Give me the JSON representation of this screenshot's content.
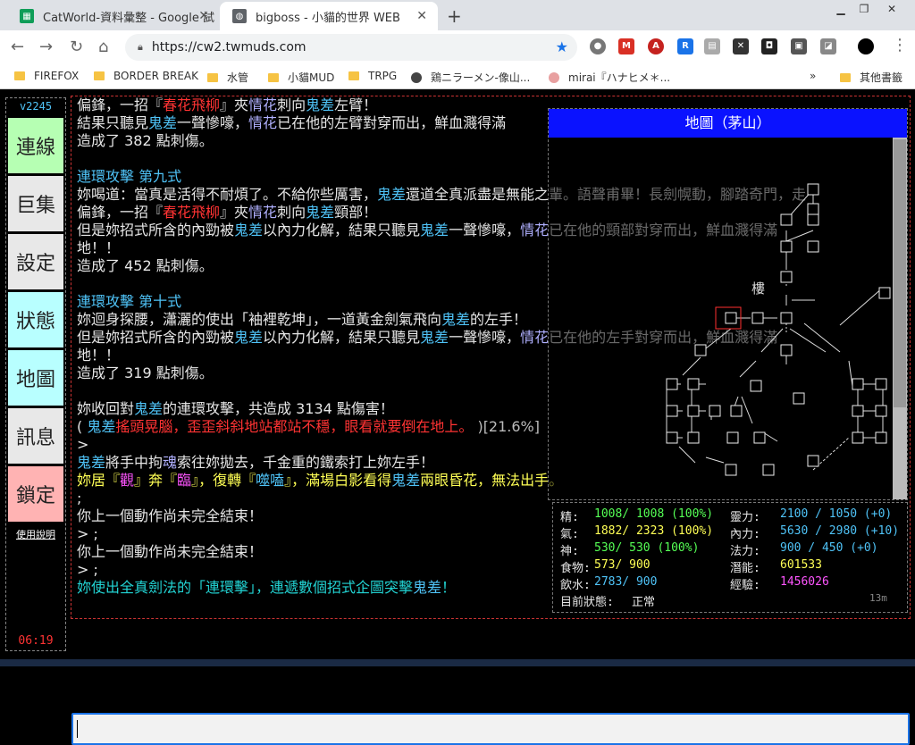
{
  "browser": {
    "tabs": [
      {
        "title": "CatWorld-資料彙整 - Google 試",
        "icon": "sheets-icon",
        "color": "#0f9d58"
      },
      {
        "title": "bigboss - 小貓的世界 WEB",
        "icon": "globe-icon",
        "color": "#5f6368"
      }
    ],
    "url": "https://cw2.twmuds.com",
    "bookmarks": [
      "FIREFOX",
      "BORDER BREAK",
      "水管",
      "小貓MUD",
      "TRPG",
      "鶏ニラーメン-像山...",
      "mirai『ハナヒメ＊...",
      "其他書籤"
    ]
  },
  "sidebar": {
    "version": "v2245",
    "buttons": [
      {
        "label": "連線",
        "color": "#b6ffb3"
      },
      {
        "label": "巨集",
        "color": "#e8e8e8"
      },
      {
        "label": "設定",
        "color": "#e8e8e8"
      },
      {
        "label": "狀態",
        "color": "#b8ffff"
      },
      {
        "label": "地圖",
        "color": "#b8ffff"
      },
      {
        "label": "訊息",
        "color": "#e8e8e8"
      },
      {
        "label": "鎖定",
        "color": "#ffb3b3"
      }
    ],
    "help": "使用說明",
    "clock": "06:19"
  },
  "output": [
    [
      [
        "偏鋒，一招『",
        "#e6e6e6"
      ],
      [
        "春花飛柳",
        "#ff3333"
      ],
      [
        "』夾",
        "#e6e6e6"
      ],
      [
        "情花",
        "#b0b0ff"
      ],
      [
        "刺向",
        "#e6e6e6"
      ],
      [
        "鬼差",
        "#4fc3f7"
      ],
      [
        "左臂！",
        "#e6e6e6"
      ]
    ],
    [
      [
        "結果只聽見",
        "#e6e6e6"
      ],
      [
        "鬼差",
        "#4fc3f7"
      ],
      [
        "一聲慘嚎，",
        "#e6e6e6"
      ],
      [
        "情花",
        "#b0b0ff"
      ],
      [
        "已在他的左臂對穿而出，鮮血濺得滿",
        "#e6e6e6"
      ]
    ],
    [
      [
        "造成了 382 點刺傷。",
        "#e6e6e6"
      ]
    ],
    [
      [
        "",
        "#e6e6e6"
      ]
    ],
    [
      [
        "連環攻擊 第九式",
        "#4fc3f7"
      ]
    ],
    [
      [
        "妳喝道：當真是活得不耐煩了。不給你些厲害，",
        "#e6e6e6"
      ],
      [
        "鬼差",
        "#4fc3f7"
      ],
      [
        "還道全真派盡是無能之輩。語聲甫畢！長劍幌動，腳踏奇門，走",
        "#e6e6e6"
      ]
    ],
    [
      [
        "偏鋒，一招『",
        "#e6e6e6"
      ],
      [
        "春花飛柳",
        "#ff3333"
      ],
      [
        "』夾",
        "#e6e6e6"
      ],
      [
        "情花",
        "#b0b0ff"
      ],
      [
        "刺向",
        "#e6e6e6"
      ],
      [
        "鬼差",
        "#4fc3f7"
      ],
      [
        "頸部！",
        "#e6e6e6"
      ]
    ],
    [
      [
        "但是妳招式所含的內勁被",
        "#e6e6e6"
      ],
      [
        "鬼差",
        "#4fc3f7"
      ],
      [
        "以內力化解，結果只聽見",
        "#e6e6e6"
      ],
      [
        "鬼差",
        "#4fc3f7"
      ],
      [
        "一聲慘嚎，",
        "#e6e6e6"
      ],
      [
        "情花",
        "#b0b0ff"
      ],
      [
        "已在他的頸部對穿而出，鮮血濺得滿",
        "#e6e6e6"
      ]
    ],
    [
      [
        "地！！",
        "#e6e6e6"
      ]
    ],
    [
      [
        "造成了 452 點刺傷。",
        "#e6e6e6"
      ]
    ],
    [
      [
        "",
        "#e6e6e6"
      ]
    ],
    [
      [
        "連環攻擊 第十式",
        "#4fc3f7"
      ]
    ],
    [
      [
        "妳迴身探腰，瀟灑的使出「袖裡乾坤」，一道黃金劍氣飛向",
        "#e6e6e6"
      ],
      [
        "鬼差",
        "#4fc3f7"
      ],
      [
        "的左手！",
        "#e6e6e6"
      ]
    ],
    [
      [
        "但是妳招式所含的內勁被",
        "#e6e6e6"
      ],
      [
        "鬼差",
        "#4fc3f7"
      ],
      [
        "以內力化解，結果只聽見",
        "#e6e6e6"
      ],
      [
        "鬼差",
        "#4fc3f7"
      ],
      [
        "一聲慘嚎，",
        "#e6e6e6"
      ],
      [
        "情花",
        "#b0b0ff"
      ],
      [
        "已在他的左手對穿而出，鮮血濺得滿",
        "#e6e6e6"
      ]
    ],
    [
      [
        "地！！",
        "#e6e6e6"
      ]
    ],
    [
      [
        "造成了 319 點刺傷。",
        "#e6e6e6"
      ]
    ],
    [
      [
        "",
        "#e6e6e6"
      ]
    ],
    [
      [
        "妳收回對",
        "#e6e6e6"
      ],
      [
        "鬼差",
        "#4fc3f7"
      ],
      [
        "的連環攻擊，共造成 3134 點傷害！",
        "#e6e6e6"
      ]
    ],
    [
      [
        "( ",
        "#e6e6e6"
      ],
      [
        "鬼差",
        "#4fc3f7"
      ],
      [
        "搖頭晃腦，歪歪斜斜地站都站不穩，眼看就要倒在地上。",
        "#ff3333"
      ],
      [
        " )[21.6%]",
        "#bbbbbb"
      ]
    ],
    [
      [
        ">",
        "#e6e6e6"
      ]
    ],
    [
      [
        "鬼差",
        "#4fc3f7"
      ],
      [
        "將手中拘",
        "#e6e6e6"
      ],
      [
        "魂",
        "#b0b0ff"
      ],
      [
        "索往妳拋去，千金重的鐵索打上妳左手！",
        "#e6e6e6"
      ]
    ],
    [
      [
        "妳居『",
        "#ffff55"
      ],
      [
        "觀",
        "#ff55ff"
      ],
      [
        "』奔『",
        "#ffff55"
      ],
      [
        "臨",
        "#ff55ff"
      ],
      [
        "』，復轉『",
        "#ffff55"
      ],
      [
        "噬嗑",
        "#4fc3f7"
      ],
      [
        "』，滿場白影看得",
        "#ffff55"
      ],
      [
        "鬼差",
        "#4fc3f7"
      ],
      [
        "兩眼昏花，無法出手。",
        "#ffff55"
      ]
    ],
    [
      [
        ";",
        "#e6e6e6"
      ]
    ],
    [
      [
        "你上一個動作尚未完全結束！",
        "#e6e6e6"
      ]
    ],
    [
      [
        "> ;",
        "#e6e6e6"
      ]
    ],
    [
      [
        "你上一個動作尚未完全結束！",
        "#e6e6e6"
      ]
    ],
    [
      [
        "> ;",
        "#e6e6e6"
      ]
    ],
    [
      [
        "妳使出全真劍法的「連環擊」，連遞數個招式企圖突擊",
        "#22d3d3"
      ],
      [
        "鬼差",
        "#4fc3f7"
      ],
      [
        "！",
        "#22d3d3"
      ]
    ]
  ],
  "map": {
    "title": "地圖（茅山）",
    "tower_label": "樓"
  },
  "status": {
    "rows": [
      {
        "l_label": "精:",
        "l_value": "1008/ 1008 (100%)",
        "r_label": "靈力:",
        "r_value": "2100 / 1050 (+0)"
      },
      {
        "l_label": "氣:",
        "l_value": "1882/ 2323 (100%)",
        "r_label": "內力:",
        "r_value": "5630 / 2980 (+10)"
      },
      {
        "l_label": "神:",
        "l_value": " 530/  530 (100%)",
        "r_label": "法力:",
        "r_value": " 900 /  450 (+0)"
      },
      {
        "l_label": "食物:",
        "l_value": " 573/  900",
        "r_label": "潛能:",
        "r_value": "601533"
      },
      {
        "l_label": "飲水:",
        "l_value": "2783/  900",
        "r_label": "經驗:",
        "r_value": "1456026"
      }
    ],
    "state_label": "目前狀態:",
    "state_value": "正常",
    "timer": "13m"
  },
  "input": {
    "value": ""
  }
}
